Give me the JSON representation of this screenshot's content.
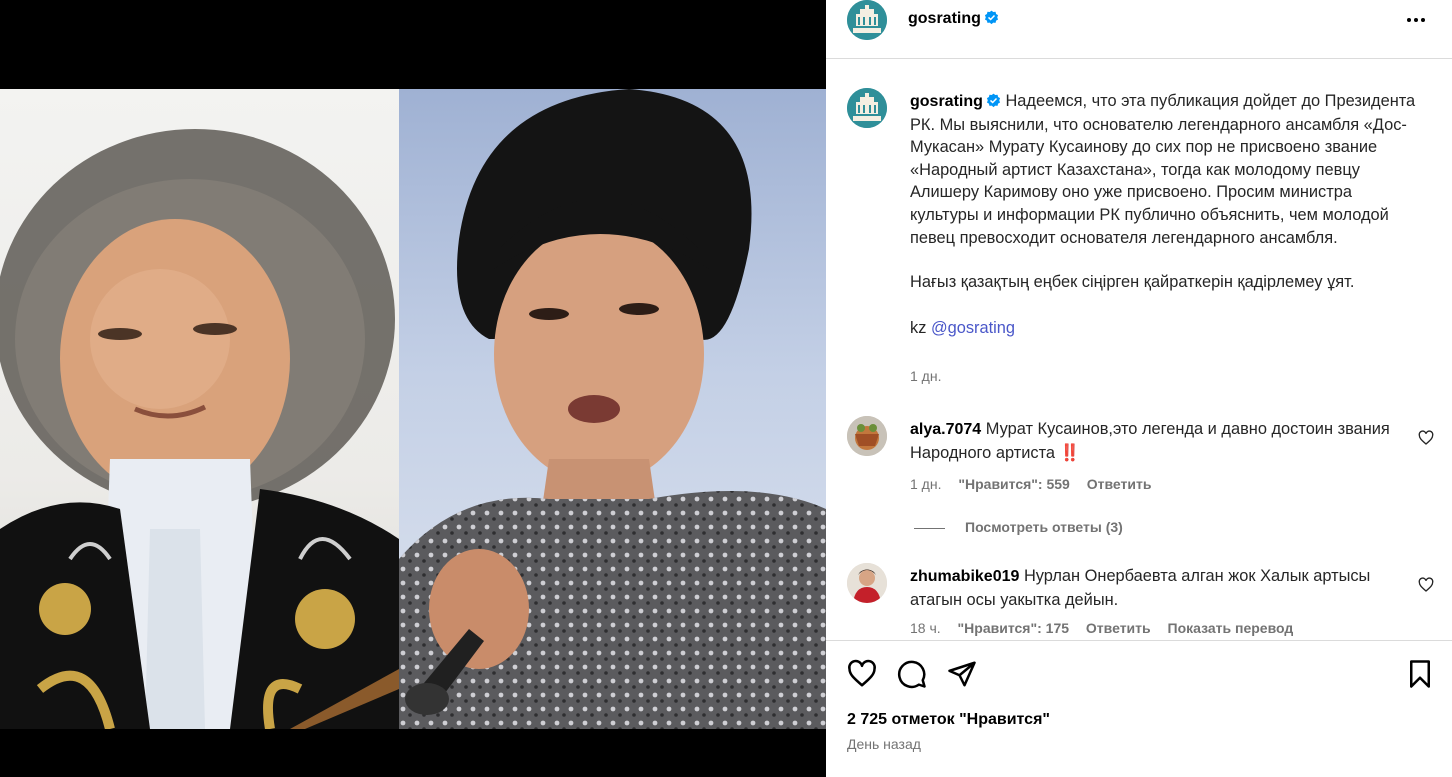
{
  "post": {
    "username": "gosrating",
    "avatar_icon": "gosrating-logo-icon",
    "verified_icon": "verified-badge-icon"
  },
  "caption": {
    "username": "gosrating",
    "text": "Надеемся, что эта публикация дойдет до Президента РК. Мы выяснили, что основателю легендарного ансамбля «Дос-Мукасан» Мурату Кусаинову до сих пор не присвоено звание «Народный артист Казахстана», тогда как молодому певцу Алишеру Каримову оно уже присвоено. Просим министра культуры и информации РК публично объяснить, чем молодой певец превосходит основателя легендарного ансамбля.",
    "text2": "Нағыз қазақтың еңбек сіңірген қайраткерін қадірлемеу ұят.",
    "lang_prefix": "kz ",
    "mention": "@gosrating",
    "time": "1 дн."
  },
  "comments": [
    {
      "username": "alya.7074",
      "text": "Мурат Кусаинов,это легенда и давно достоин звания Народного артиста ",
      "emoji": "‼️",
      "time": "1 дн.",
      "likes": "\"Нравится\": 559",
      "reply": "Ответить",
      "view_replies": "Посмотреть ответы (3)"
    },
    {
      "username": "zhumabike019",
      "text": "Нурлан Онербаевта алган жок Халык артысы атагын осы уакытка дейын.",
      "time": "18 ч.",
      "likes": "\"Нравится\": 175",
      "reply": "Ответить",
      "translate": "Показать перевод"
    }
  ],
  "footer": {
    "likes": "2 725 отметок \"Нравится\"",
    "date": "День назад"
  },
  "colors": {
    "avatar_bg": "#2f8f99",
    "verified": "#0095f6",
    "mention": "#4a57c9",
    "emoji_red": "#e0245e"
  }
}
